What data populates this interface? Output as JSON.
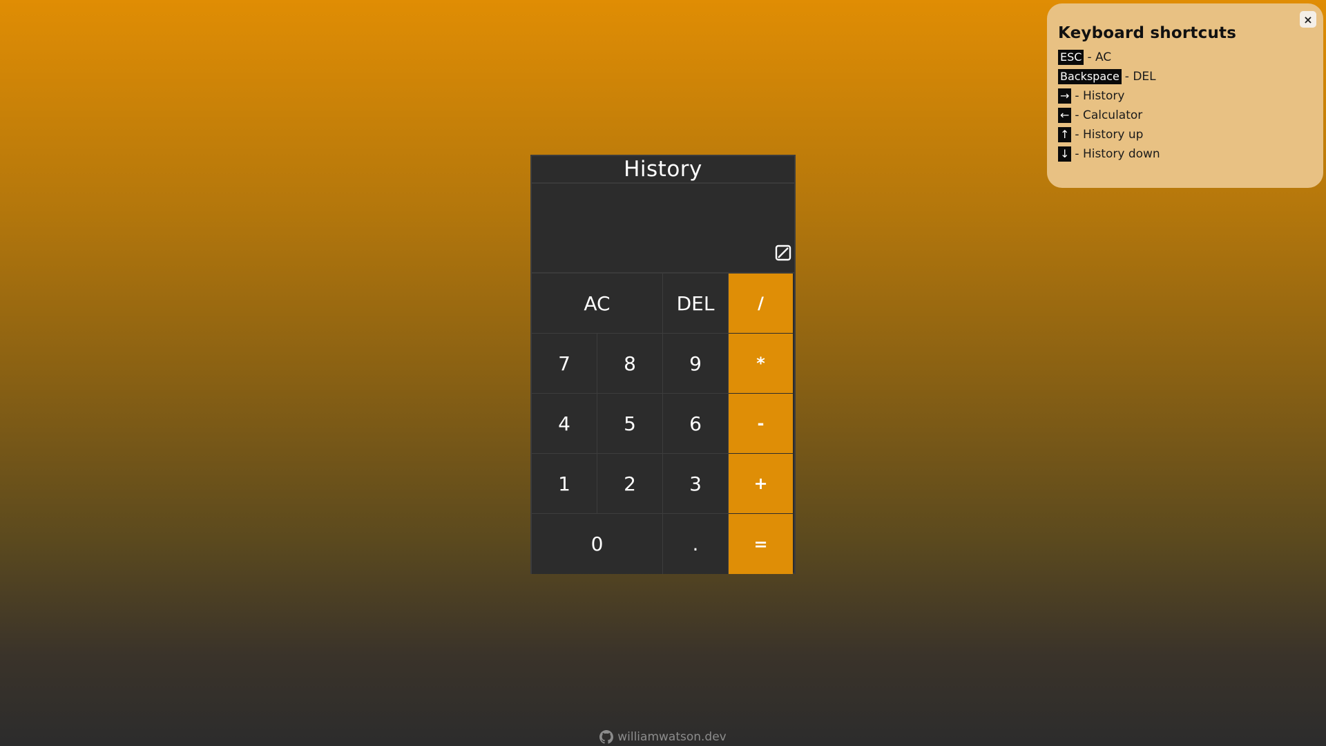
{
  "calculator": {
    "header": "History",
    "display_icon": "empty-set-icon",
    "keys": {
      "ac": "AC",
      "del": "DEL",
      "divide": "/",
      "seven": "7",
      "eight": "8",
      "nine": "9",
      "multiply": "*",
      "four": "4",
      "five": "5",
      "six": "6",
      "minus": "-",
      "one": "1",
      "two": "2",
      "three": "3",
      "plus": "+",
      "zero": "0",
      "dot": ".",
      "equals": "="
    }
  },
  "shortcuts": {
    "title": "Keyboard shortcuts",
    "close": "×",
    "rows": [
      {
        "key": "ESC",
        "action": "- AC"
      },
      {
        "key": "Backspace",
        "action": "- DEL"
      },
      {
        "key": "→",
        "action": "- History"
      },
      {
        "key": "←",
        "action": "- Calculator"
      },
      {
        "key": "↑",
        "action": "- History up"
      },
      {
        "key": "↓",
        "action": "- History down"
      }
    ]
  },
  "footer": {
    "icon": "github-icon",
    "text": "williamwatson.dev"
  },
  "colors": {
    "accent": "#df8e06",
    "panel": "#2c2c2c",
    "shortcuts_bg": "#e8c183"
  }
}
